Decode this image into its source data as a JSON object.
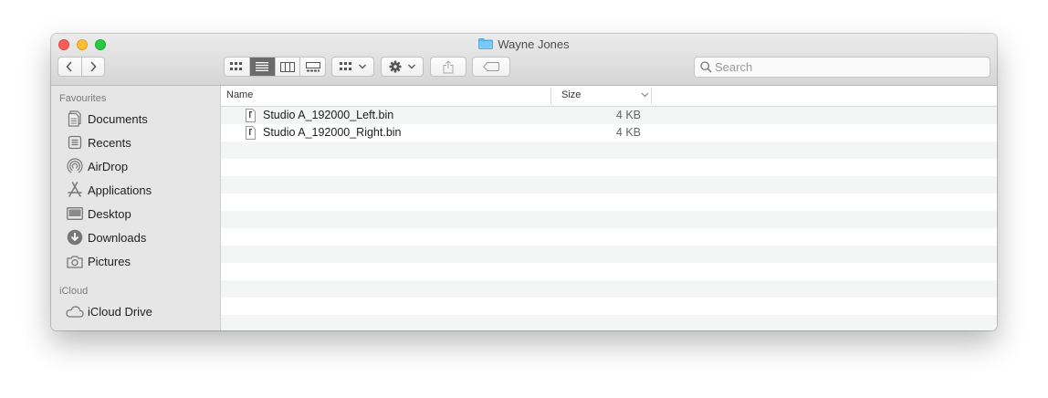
{
  "window": {
    "title": "Wayne Jones"
  },
  "toolbar": {
    "back_icon": "chevron-left-icon",
    "forward_icon": "chevron-right-icon",
    "views": [
      "icon-view-icon",
      "list-view-icon",
      "column-view-icon",
      "gallery-view-icon"
    ],
    "active_view": "list-view-icon",
    "group_icon": "group-by-icon",
    "action_icon": "gear-icon",
    "share_icon": "share-icon",
    "tag_icon": "tag-icon"
  },
  "search": {
    "placeholder": "Search",
    "value": ""
  },
  "sidebar": {
    "favourites_title": "Favourites",
    "items": [
      {
        "label": "Documents",
        "icon": "documents-icon"
      },
      {
        "label": "Recents",
        "icon": "recents-icon"
      },
      {
        "label": "AirDrop",
        "icon": "airdrop-icon"
      },
      {
        "label": "Applications",
        "icon": "applications-icon"
      },
      {
        "label": "Desktop",
        "icon": "desktop-icon"
      },
      {
        "label": "Downloads",
        "icon": "downloads-icon"
      },
      {
        "label": "Pictures",
        "icon": "pictures-icon"
      }
    ],
    "icloud_title": "iCloud",
    "icloud_items": [
      {
        "label": "iCloud Drive",
        "icon": "cloud-icon"
      }
    ]
  },
  "list": {
    "columns": {
      "name": "Name",
      "size": "Size"
    },
    "files": [
      {
        "name": "Studio A_192000_Left.bin",
        "size": "4 KB"
      },
      {
        "name": "Studio A_192000_Right.bin",
        "size": "4 KB"
      }
    ]
  },
  "colors": {
    "close": "#fd5f57",
    "minimize": "#febc2e",
    "maximize": "#28c840",
    "folder": "#5ab8f2",
    "sidebar_icon": "#777777"
  }
}
